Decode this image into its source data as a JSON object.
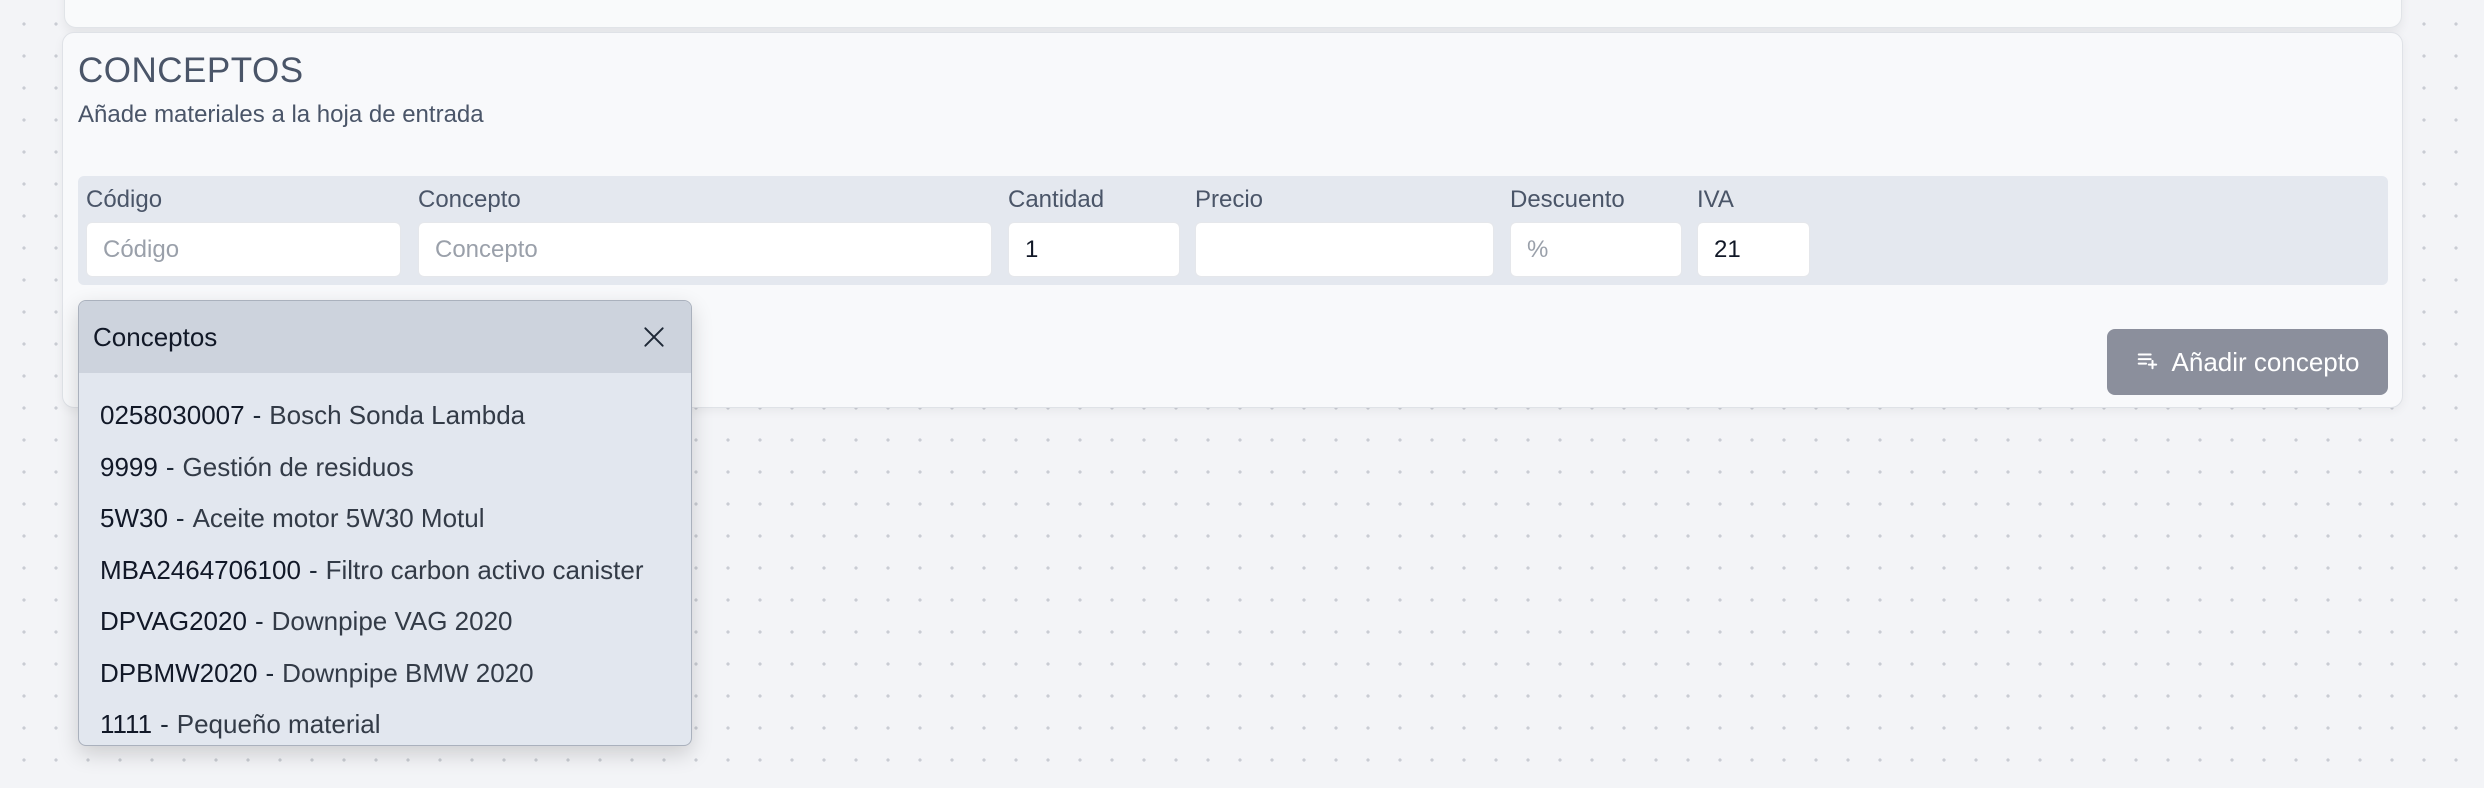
{
  "section": {
    "title": "CONCEPTOS",
    "subtitle": "Añade materiales a la hoja de entrada"
  },
  "form": {
    "codigo": {
      "label": "Código",
      "placeholder": "Código",
      "value": ""
    },
    "concepto": {
      "label": "Concepto",
      "placeholder": "Concepto",
      "value": ""
    },
    "cantidad": {
      "label": "Cantidad",
      "placeholder": "",
      "value": "1"
    },
    "precio": {
      "label": "Precio",
      "placeholder": "",
      "value": ""
    },
    "descuento": {
      "label": "Descuento",
      "placeholder": "%",
      "value": ""
    },
    "iva": {
      "label": "IVA",
      "placeholder": "",
      "value": "21"
    }
  },
  "add_button": {
    "label": "Añadir concepto",
    "icon": "playlist-add-icon"
  },
  "dropdown": {
    "title": "Conceptos",
    "close_icon": "close-icon",
    "items": [
      {
        "code": "0258030007",
        "separator": "-",
        "name": "Bosch Sonda Lambda"
      },
      {
        "code": "9999",
        "separator": "-",
        "name": "Gestión de residuos"
      },
      {
        "code": "5W30",
        "separator": "-",
        "name": "Aceite motor 5W30 Motul"
      },
      {
        "code": "MBA2464706100",
        "separator": "-",
        "name": "Filtro carbon activo canister"
      },
      {
        "code": "DPVAG2020",
        "separator": "-",
        "name": "Downpipe VAG 2020"
      },
      {
        "code": "DPBMW2020",
        "separator": "-",
        "name": "Downpipe BMW 2020"
      },
      {
        "code": "1111",
        "separator": "-",
        "name": "Pequeño material"
      }
    ]
  },
  "colors": {
    "button_bg": "#8b8f9c",
    "fields_bg": "#e4e8ef",
    "dropdown_header_bg": "#cdd3dd",
    "dropdown_bg": "#e2e7ef"
  }
}
